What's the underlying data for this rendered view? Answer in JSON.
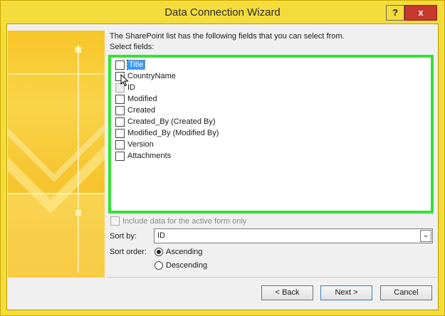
{
  "window": {
    "title": "Data Connection Wizard",
    "help_label": "?",
    "close_label": "x"
  },
  "main": {
    "instruction": "The SharePoint list has the following fields that you can select from.",
    "select_fields_label": "Select fields:",
    "fields": [
      {
        "label": "Title",
        "checked": false,
        "selected": true
      },
      {
        "label": "CountryName",
        "checked": false
      },
      {
        "label": "ID",
        "checked": false
      },
      {
        "label": "Modified",
        "checked": false
      },
      {
        "label": "Created",
        "checked": false
      },
      {
        "label": "Created_By (Created By)",
        "checked": false
      },
      {
        "label": "Modified_By (Modified By)",
        "checked": false
      },
      {
        "label": "Version",
        "checked": false
      },
      {
        "label": "Attachments",
        "checked": false
      }
    ],
    "include_data_label": "Include data for the active form only",
    "sort_by_label": "Sort by:",
    "sort_by_value": "ID",
    "sort_order_label": "Sort order:",
    "ascending_label": "Ascending",
    "descending_label": "Descending",
    "sort_order_selected": "Ascending"
  },
  "buttons": {
    "back": "< Back",
    "next": "Next >",
    "cancel": "Cancel"
  },
  "colors": {
    "frame": "#f4dc3c",
    "highlight_border": "#33e333",
    "close": "#c7392d",
    "selection": "#3399ff"
  }
}
